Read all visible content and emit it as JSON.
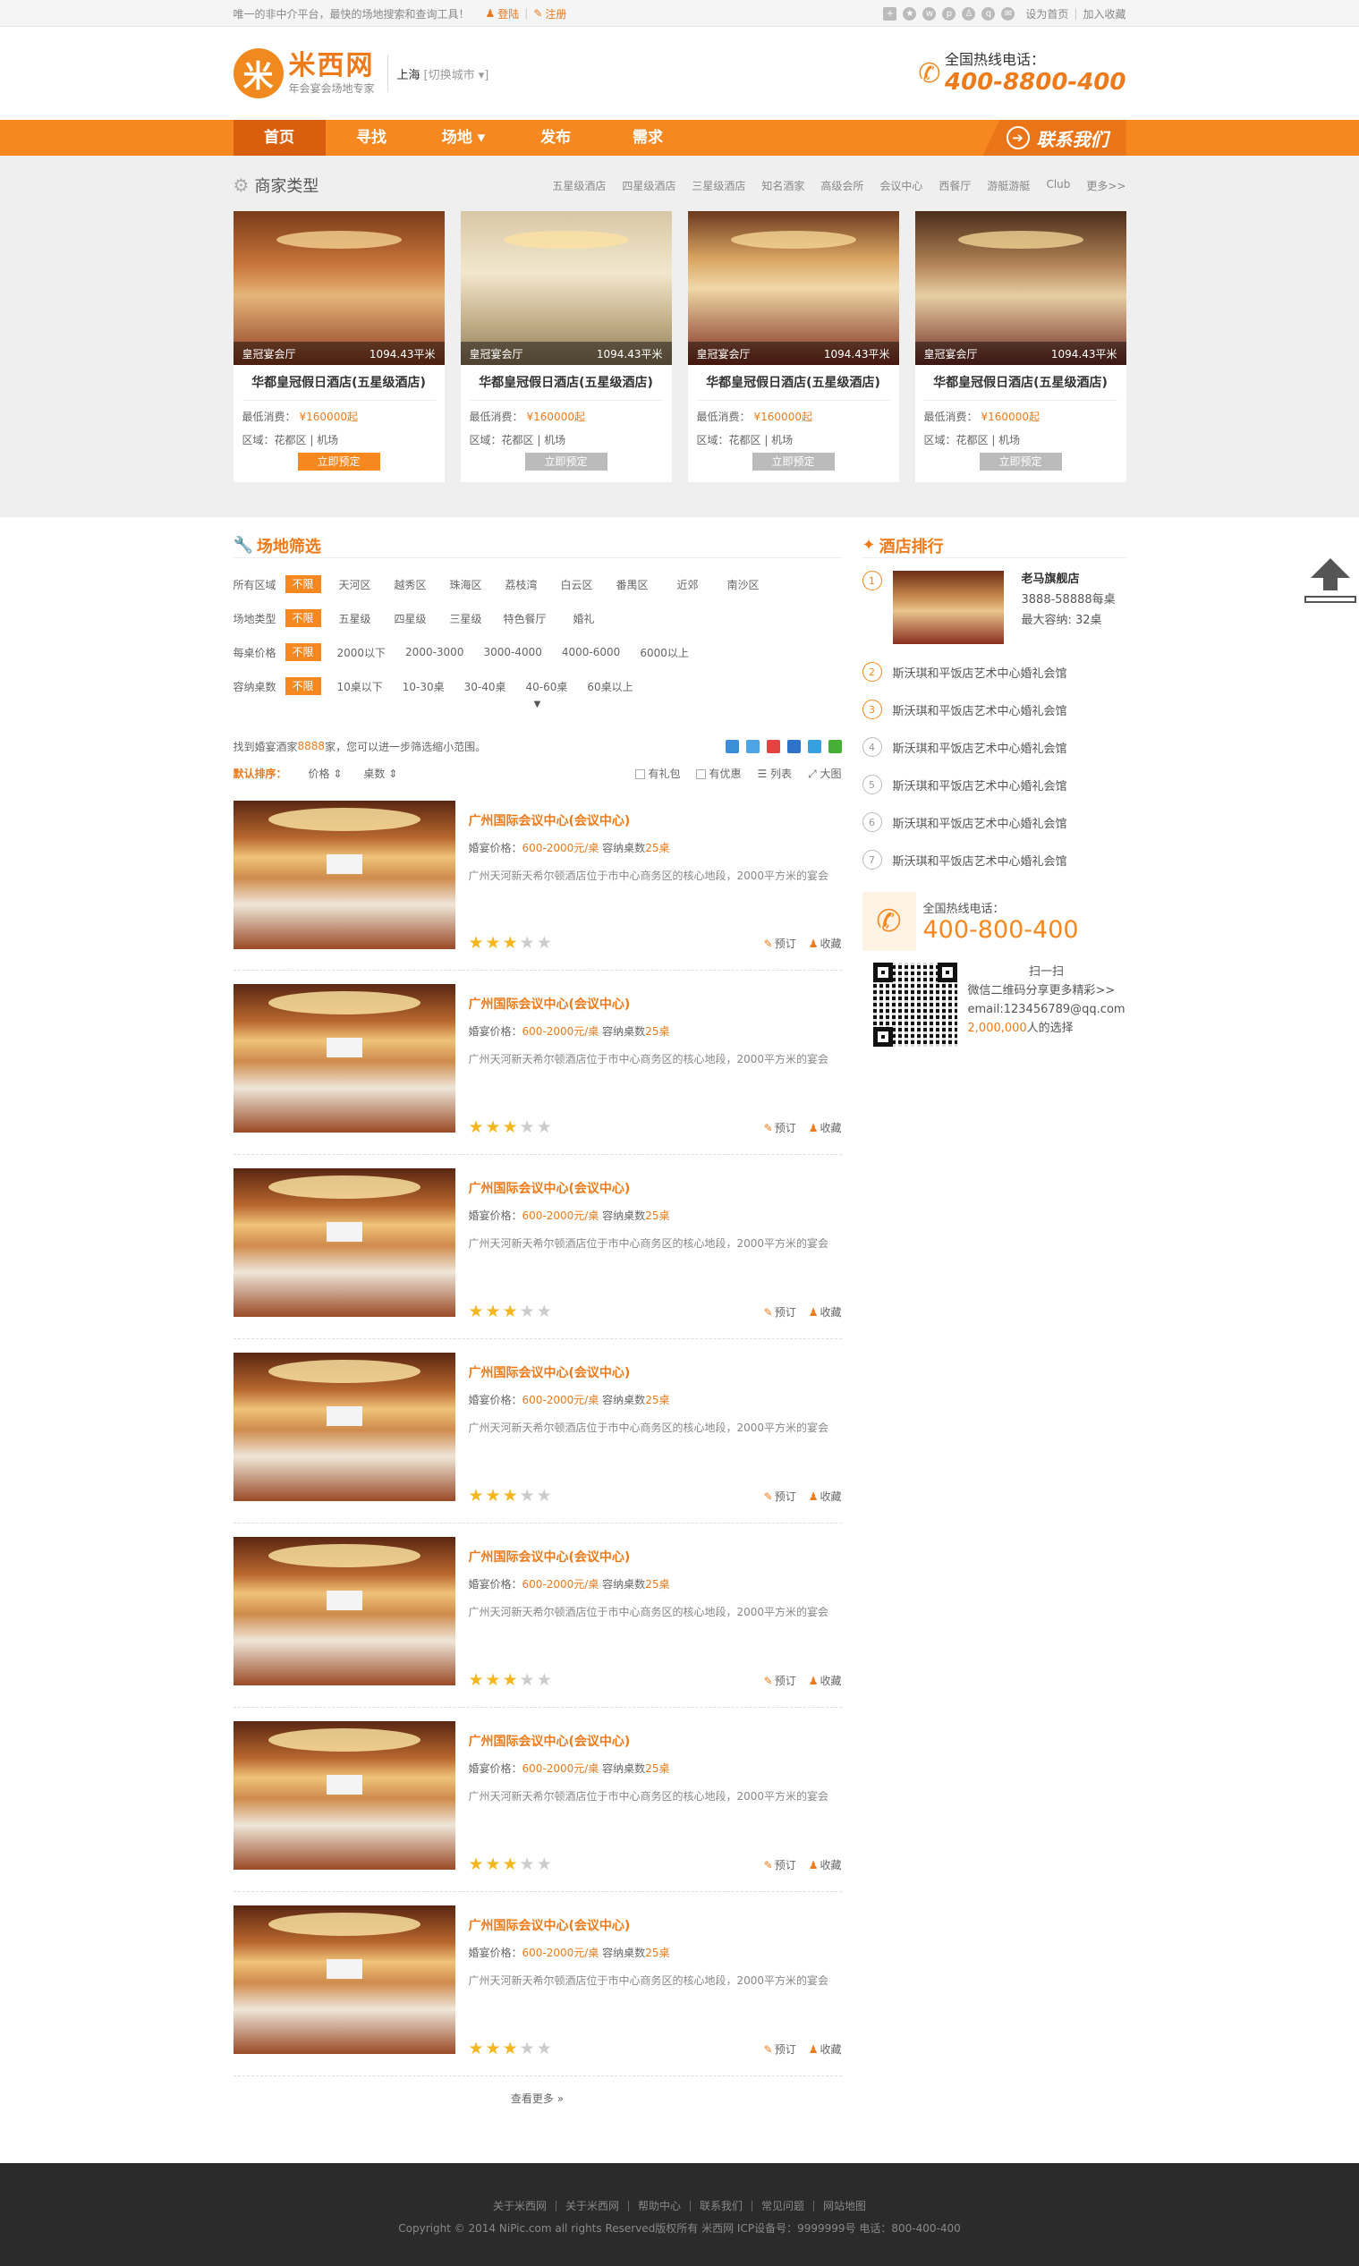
{
  "topbar": {
    "welcome": "唯一的非中介平台，最快的场地搜索和查询工具！",
    "login": "登陆",
    "register": "注册",
    "set_home": "设为首页",
    "add_fav": "加入收藏"
  },
  "header": {
    "logo_char": "米",
    "logo_name": "米西网",
    "slogan": "年会宴会场地专家",
    "city": "上海",
    "switch_city": "[切换城市 ▾]",
    "hotline_label": "全国热线电话：",
    "hotline_number": "400-8800-400"
  },
  "nav": {
    "items": [
      "首页",
      "寻找",
      "场地 ▾",
      "发布",
      "需求"
    ],
    "contact": "联系我们"
  },
  "types": {
    "title": "商家类型",
    "links": [
      "五星级酒店",
      "四星级酒店",
      "三星级酒店",
      "知名酒家",
      "高级会所",
      "会议中心",
      "西餐厅",
      "游艇游艇",
      "Club",
      "更多>>"
    ]
  },
  "cards": [
    {
      "hall": "皇冠宴会厅",
      "area": "1094.43平米",
      "name": "华都皇冠假日酒店(五星级酒店)",
      "price_label": "最低消费：",
      "price": "¥160000起",
      "district": "区域：花都区 | 机场",
      "button": "立即预定",
      "active": true
    },
    {
      "hall": "皇冠宴会厅",
      "area": "1094.43平米",
      "name": "华都皇冠假日酒店(五星级酒店)",
      "price_label": "最低消费：",
      "price": "¥160000起",
      "district": "区域：花都区 | 机场",
      "button": "立即预定",
      "active": false
    },
    {
      "hall": "皇冠宴会厅",
      "area": "1094.43平米",
      "name": "华都皇冠假日酒店(五星级酒店)",
      "price_label": "最低消费：",
      "price": "¥160000起",
      "district": "区域：花都区 | 机场",
      "button": "立即预定",
      "active": false
    },
    {
      "hall": "皇冠宴会厅",
      "area": "1094.43平米",
      "name": "华都皇冠假日酒店(五星级酒店)",
      "price_label": "最低消费：",
      "price": "¥160000起",
      "district": "区域：花都区 | 机场",
      "button": "立即预定",
      "active": false
    }
  ],
  "filter": {
    "title": "场地筛选",
    "rows": [
      {
        "label": "所有区域",
        "options": [
          "不限",
          "天河区",
          "越秀区",
          "珠海区",
          "荔枝湾",
          "白云区",
          "番禺区",
          "近郊",
          "南沙区"
        ]
      },
      {
        "label": "场地类型",
        "options": [
          "不限",
          "五星级",
          "四星级",
          "三星级",
          "特色餐厅",
          "婚礼"
        ]
      },
      {
        "label": "每桌价格",
        "options": [
          "不限",
          "2000以下",
          "2000-3000",
          "3000-4000",
          "4000-6000",
          "6000以上"
        ]
      },
      {
        "label": "容纳桌数",
        "options": [
          "不限",
          "10桌以下",
          "10-30桌",
          "30-40桌",
          "40-60桌",
          "60桌以上"
        ]
      }
    ],
    "result_pre": "找到婚宴酒家",
    "result_count": "8888",
    "result_post": "家，您可以进一步筛选缩小范围。",
    "sort_default": "默认排序：",
    "sort_price": "价格 ⇕",
    "sort_tables": "桌数 ⇕",
    "has_gift": "有礼包",
    "has_discount": "有优惠",
    "view_list": "列表",
    "view_large": "大图"
  },
  "venues": [
    {
      "title": "广州国际会议中心(会议中心)",
      "price_label": "婚宴价格：",
      "price": "600-2000元/桌",
      "tables_label": "容纳桌数",
      "tables": "25桌",
      "desc": "广州天河新天希尔顿酒店位于市中心商务区的核心地段，2000平方米的宴会",
      "stars": 3,
      "book": "预订",
      "fav": "收藏"
    },
    {
      "title": "广州国际会议中心(会议中心)",
      "price_label": "婚宴价格：",
      "price": "600-2000元/桌",
      "tables_label": "容纳桌数",
      "tables": "25桌",
      "desc": "广州天河新天希尔顿酒店位于市中心商务区的核心地段，2000平方米的宴会",
      "stars": 3,
      "book": "预订",
      "fav": "收藏"
    },
    {
      "title": "广州国际会议中心(会议中心)",
      "price_label": "婚宴价格：",
      "price": "600-2000元/桌",
      "tables_label": "容纳桌数",
      "tables": "25桌",
      "desc": "广州天河新天希尔顿酒店位于市中心商务区的核心地段，2000平方米的宴会",
      "stars": 3,
      "book": "预订",
      "fav": "收藏"
    },
    {
      "title": "广州国际会议中心(会议中心)",
      "price_label": "婚宴价格：",
      "price": "600-2000元/桌",
      "tables_label": "容纳桌数",
      "tables": "25桌",
      "desc": "广州天河新天希尔顿酒店位于市中心商务区的核心地段，2000平方米的宴会",
      "stars": 3,
      "book": "预订",
      "fav": "收藏"
    },
    {
      "title": "广州国际会议中心(会议中心)",
      "price_label": "婚宴价格：",
      "price": "600-2000元/桌",
      "tables_label": "容纳桌数",
      "tables": "25桌",
      "desc": "广州天河新天希尔顿酒店位于市中心商务区的核心地段，2000平方米的宴会",
      "stars": 3,
      "book": "预订",
      "fav": "收藏"
    },
    {
      "title": "广州国际会议中心(会议中心)",
      "price_label": "婚宴价格：",
      "price": "600-2000元/桌",
      "tables_label": "容纳桌数",
      "tables": "25桌",
      "desc": "广州天河新天希尔顿酒店位于市中心商务区的核心地段，2000平方米的宴会",
      "stars": 3,
      "book": "预订",
      "fav": "收藏"
    },
    {
      "title": "广州国际会议中心(会议中心)",
      "price_label": "婚宴价格：",
      "price": "600-2000元/桌",
      "tables_label": "容纳桌数",
      "tables": "25桌",
      "desc": "广州天河新天希尔顿酒店位于市中心商务区的核心地段，2000平方米的宴会",
      "stars": 3,
      "book": "预订",
      "fav": "收藏"
    }
  ],
  "view_more": "查看更多 »",
  "rank": {
    "title": "酒店排行",
    "first": {
      "num": "1",
      "name": "老马旗舰店",
      "phone": "3888-58888每桌",
      "capacity": "最大容纳: 32桌"
    },
    "others": [
      {
        "num": "2",
        "name": "斯沃琪和平饭店艺术中心婚礼会馆"
      },
      {
        "num": "3",
        "name": "斯沃琪和平饭店艺术中心婚礼会馆"
      },
      {
        "num": "4",
        "name": "斯沃琪和平饭店艺术中心婚礼会馆"
      },
      {
        "num": "5",
        "name": "斯沃琪和平饭店艺术中心婚礼会馆"
      },
      {
        "num": "6",
        "name": "斯沃琪和平饭店艺术中心婚礼会馆"
      },
      {
        "num": "7",
        "name": "斯沃琪和平饭店艺术中心婚礼会馆"
      }
    ]
  },
  "side": {
    "hotline_label": "全国热线电话：",
    "hotline": "400-800-400",
    "scan": "扫一扫",
    "wechat": "微信二维码分享更多精彩>>",
    "email": "email:123456789@qq.com",
    "count": "2,000,000",
    "count_suffix": "人的选择"
  },
  "footer": {
    "links": [
      "关于米西网",
      "关于米西网",
      "帮助中心",
      "联系我们",
      "常见问题",
      "网站地图"
    ],
    "copyright": "Copyright © 2014 NiPic.com all rights Reserved版权所有 米西网 ICP设备号：9999999号 电话：800-400-400"
  },
  "colors": {
    "accent": "#f7881f",
    "accent_dark": "#d95f0e",
    "text": "#555555"
  }
}
